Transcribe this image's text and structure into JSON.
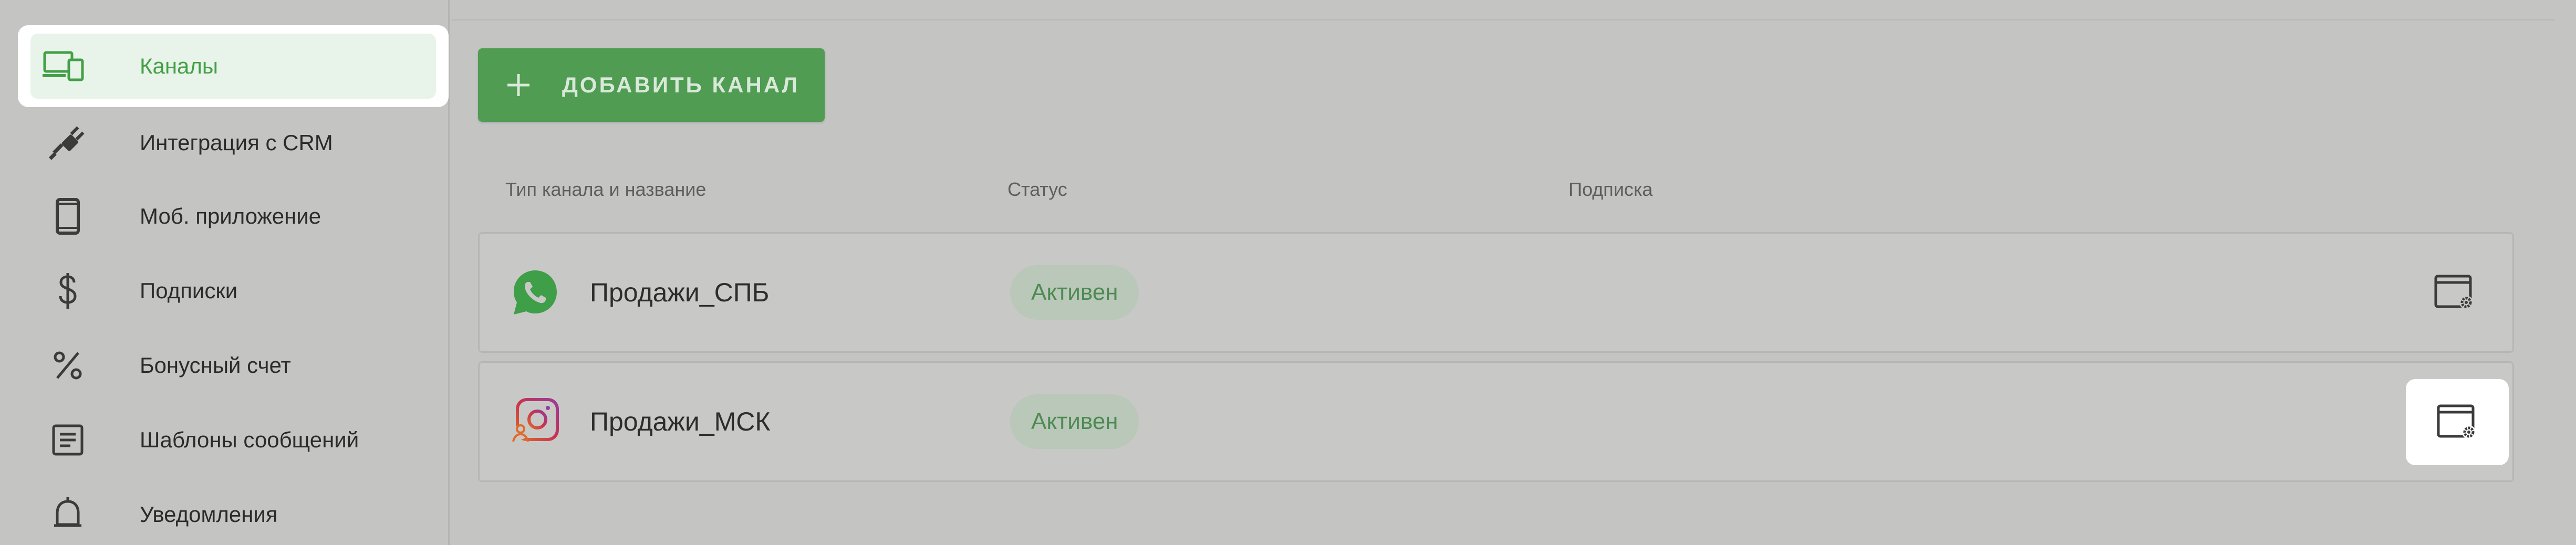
{
  "sidebar": {
    "items": [
      {
        "label": "Каналы",
        "icon": "devices-icon",
        "active": true
      },
      {
        "label": "Интеграция с CRM",
        "icon": "plug-icon"
      },
      {
        "label": "Моб. приложение",
        "icon": "smartphone-icon"
      },
      {
        "label": "Подписки",
        "icon": "dollar-icon"
      },
      {
        "label": "Бонусный счет",
        "icon": "percent-icon"
      },
      {
        "label": "Шаблоны сообщений",
        "icon": "document-icon"
      },
      {
        "label": "Уведомления",
        "icon": "bell-icon"
      }
    ]
  },
  "toolbar": {
    "add_channel_label": "ДОБАВИТЬ КАНАЛ"
  },
  "table": {
    "headers": {
      "type_name": "Тип канала и название",
      "status": "Статус",
      "subscription": "Подписка"
    },
    "rows": [
      {
        "channel_icon": "whatsapp-icon",
        "name": "Продажи_СПБ",
        "status": "Активен",
        "subscription": ""
      },
      {
        "channel_icon": "instagram-icon",
        "name": "Продажи_МСК",
        "status": "Активен",
        "subscription": ""
      }
    ]
  },
  "colors": {
    "accent_green": "#4f9c52",
    "active_text": "#43a047",
    "badge_bg": "#b9c8b9",
    "badge_text": "#4e8a52",
    "overlay_bg": "#c4c5c3",
    "highlight": "#ffffff"
  }
}
